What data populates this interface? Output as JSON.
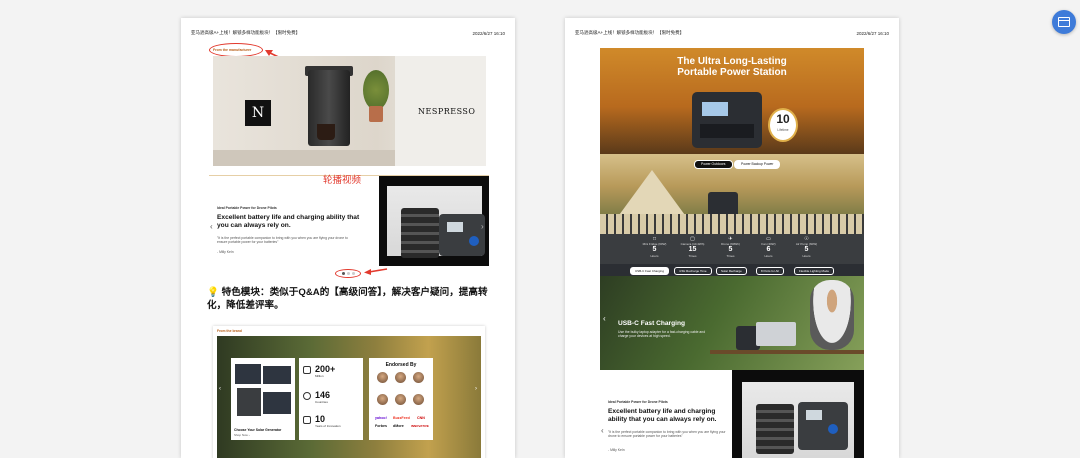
{
  "header": {
    "left_title": "亚马逊高级A+上线！解锁多样功能板块！【限时免费】",
    "date": "2022/6/27 16:10"
  },
  "left_page": {
    "from_manufacturer": "From the manufacturer",
    "nespresso_logo": "NESPRESSO",
    "nespresso_badge": "N",
    "carousel_annotation": "轮播视频",
    "video": {
      "kicker": "Ideal Portable Power for Drone Pilots",
      "heading": "Excellent battery life and charging ability that you can always rely on.",
      "body": "\"It is the perfect portable companion to bring with you when you are flying your drone to ensure portable power for your batteries\"",
      "signature": "- Milly Keln"
    },
    "feature_text": "特色模块：类似于Q&A的【高级问答】，解决客户疑问，提高转化，降低差评率。",
    "endorse_card": {
      "from_brand": "From the brand",
      "choose_label": "Choose Your Solar Generator",
      "choose_sub": "Shop Now ›",
      "stats": [
        {
          "num": "200+",
          "label": "Million"
        },
        {
          "num": "146",
          "label": "Countries"
        },
        {
          "num": "10",
          "label": "Years of Innovation"
        }
      ],
      "endorsed_by": "Endorsed By",
      "press": [
        "yahoo!",
        "BuzzFeed",
        "CNN",
        "Forbes",
        "dMore",
        "INNOVATIVE"
      ]
    }
  },
  "right_page": {
    "hero_title_1": "The Ultra Long-Lasting",
    "hero_title_2": "Portable Power Station",
    "hero_badge_num": "10",
    "hero_badge_label": "Lifetime",
    "camp_pills": [
      "Power Outdoors",
      "Power Backup Power"
    ],
    "stats": [
      {
        "icon": "□",
        "cap": "Mini Fridge (60W)",
        "num": "5",
        "unit": "Hours"
      },
      {
        "icon": "▢",
        "cap": "Camera (10.4Wh)",
        "num": "15",
        "unit": "Times"
      },
      {
        "icon": "✈",
        "cap": "Drone (60Wh)",
        "num": "5",
        "unit": "Times"
      },
      {
        "icon": "▭",
        "cap": "Fan (40W)",
        "num": "6",
        "unit": "Hours"
      },
      {
        "icon": "☉",
        "cap": "Air Pump (60W)",
        "num": "5",
        "unit": "Hours"
      }
    ],
    "charge_tabs": [
      "USB-C Fast Charging",
      "4.5H Recharge Time",
      "Solar Recharge",
      "8 Ports for All",
      "Flexible Lighting Mode"
    ],
    "charge_title": "USB-C Fast Charging",
    "charge_body": "Use the bulky laptop adapter for a fast-charging cable and charge your devices at high speed.",
    "video": {
      "kicker": "Ideal Portable Power for Drone Pilots",
      "heading": "Excellent battery life and charging ability that you can always rely on.",
      "body": "\"It is the perfect portable companion to bring with you when you are flying your drone to ensure portable power for your batteries\"",
      "signature": "- Milly Keln"
    }
  },
  "colors": {
    "annotation_red": "#e23a2e",
    "accent_blue": "#3e7bd9"
  },
  "fab_icon": "storefront-icon"
}
